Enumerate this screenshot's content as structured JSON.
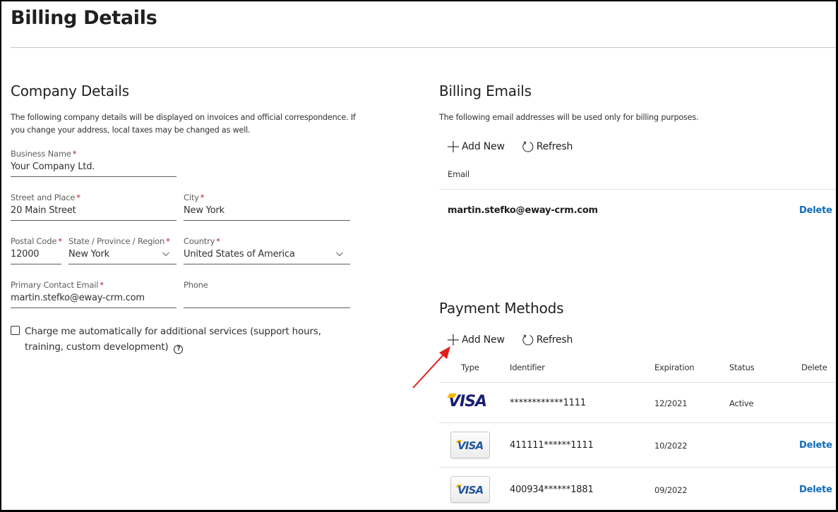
{
  "page": {
    "title": "Billing Details"
  },
  "company": {
    "heading": "Company Details",
    "description": "The following company details will be displayed on invoices and official correspondence. If you change your address, local taxes may be changed as well.",
    "fields": {
      "business_name": {
        "label": "Business Name",
        "required": "*",
        "value": "Your Company Ltd."
      },
      "street": {
        "label": "Street and Place",
        "required": "*",
        "value": "20 Main Street"
      },
      "city": {
        "label": "City",
        "required": "*",
        "value": "New York"
      },
      "postal_code": {
        "label": "Postal Code",
        "required": "*",
        "value": "12000"
      },
      "state": {
        "label": "State / Province / Region",
        "required": "*",
        "value": "New York"
      },
      "country": {
        "label": "Country",
        "required": "*",
        "value": "United States of America"
      },
      "email": {
        "label": "Primary Contact Email",
        "required": "*",
        "value": "martin.stefko@eway-crm.com"
      },
      "phone": {
        "label": "Phone",
        "value": ""
      }
    },
    "auto_charge": {
      "label": "Charge me automatically for additional services (support hours, training, custom development)",
      "checked": false,
      "help_icon": "?"
    }
  },
  "billing_emails": {
    "heading": "Billing Emails",
    "description": "The following email addresses will be used only for billing purposes.",
    "toolbar": {
      "add_label": "Add New",
      "refresh_label": "Refresh"
    },
    "columns": [
      "Email"
    ],
    "rows": [
      {
        "email": "martin.stefko@eway-crm.com",
        "action": "Delete"
      }
    ]
  },
  "payment_methods": {
    "heading": "Payment Methods",
    "toolbar": {
      "add_label": "Add New",
      "refresh_label": "Refresh"
    },
    "columns": [
      "Type",
      "Identifier",
      "Expiration",
      "Status",
      "Delete"
    ],
    "rows": [
      {
        "type": "VISA",
        "identifier": "************1111",
        "expiration": "12/2021",
        "status": "Active",
        "action": ""
      },
      {
        "type": "VISA",
        "identifier": "411111******1111",
        "expiration": "10/2022",
        "status": "",
        "action": "Delete"
      },
      {
        "type": "VISA",
        "identifier": "400934******1881",
        "expiration": "09/2022",
        "status": "",
        "action": "Delete"
      }
    ]
  },
  "annotation": {
    "color": "#e0201c",
    "target": "payment-methods-add-new-button"
  }
}
